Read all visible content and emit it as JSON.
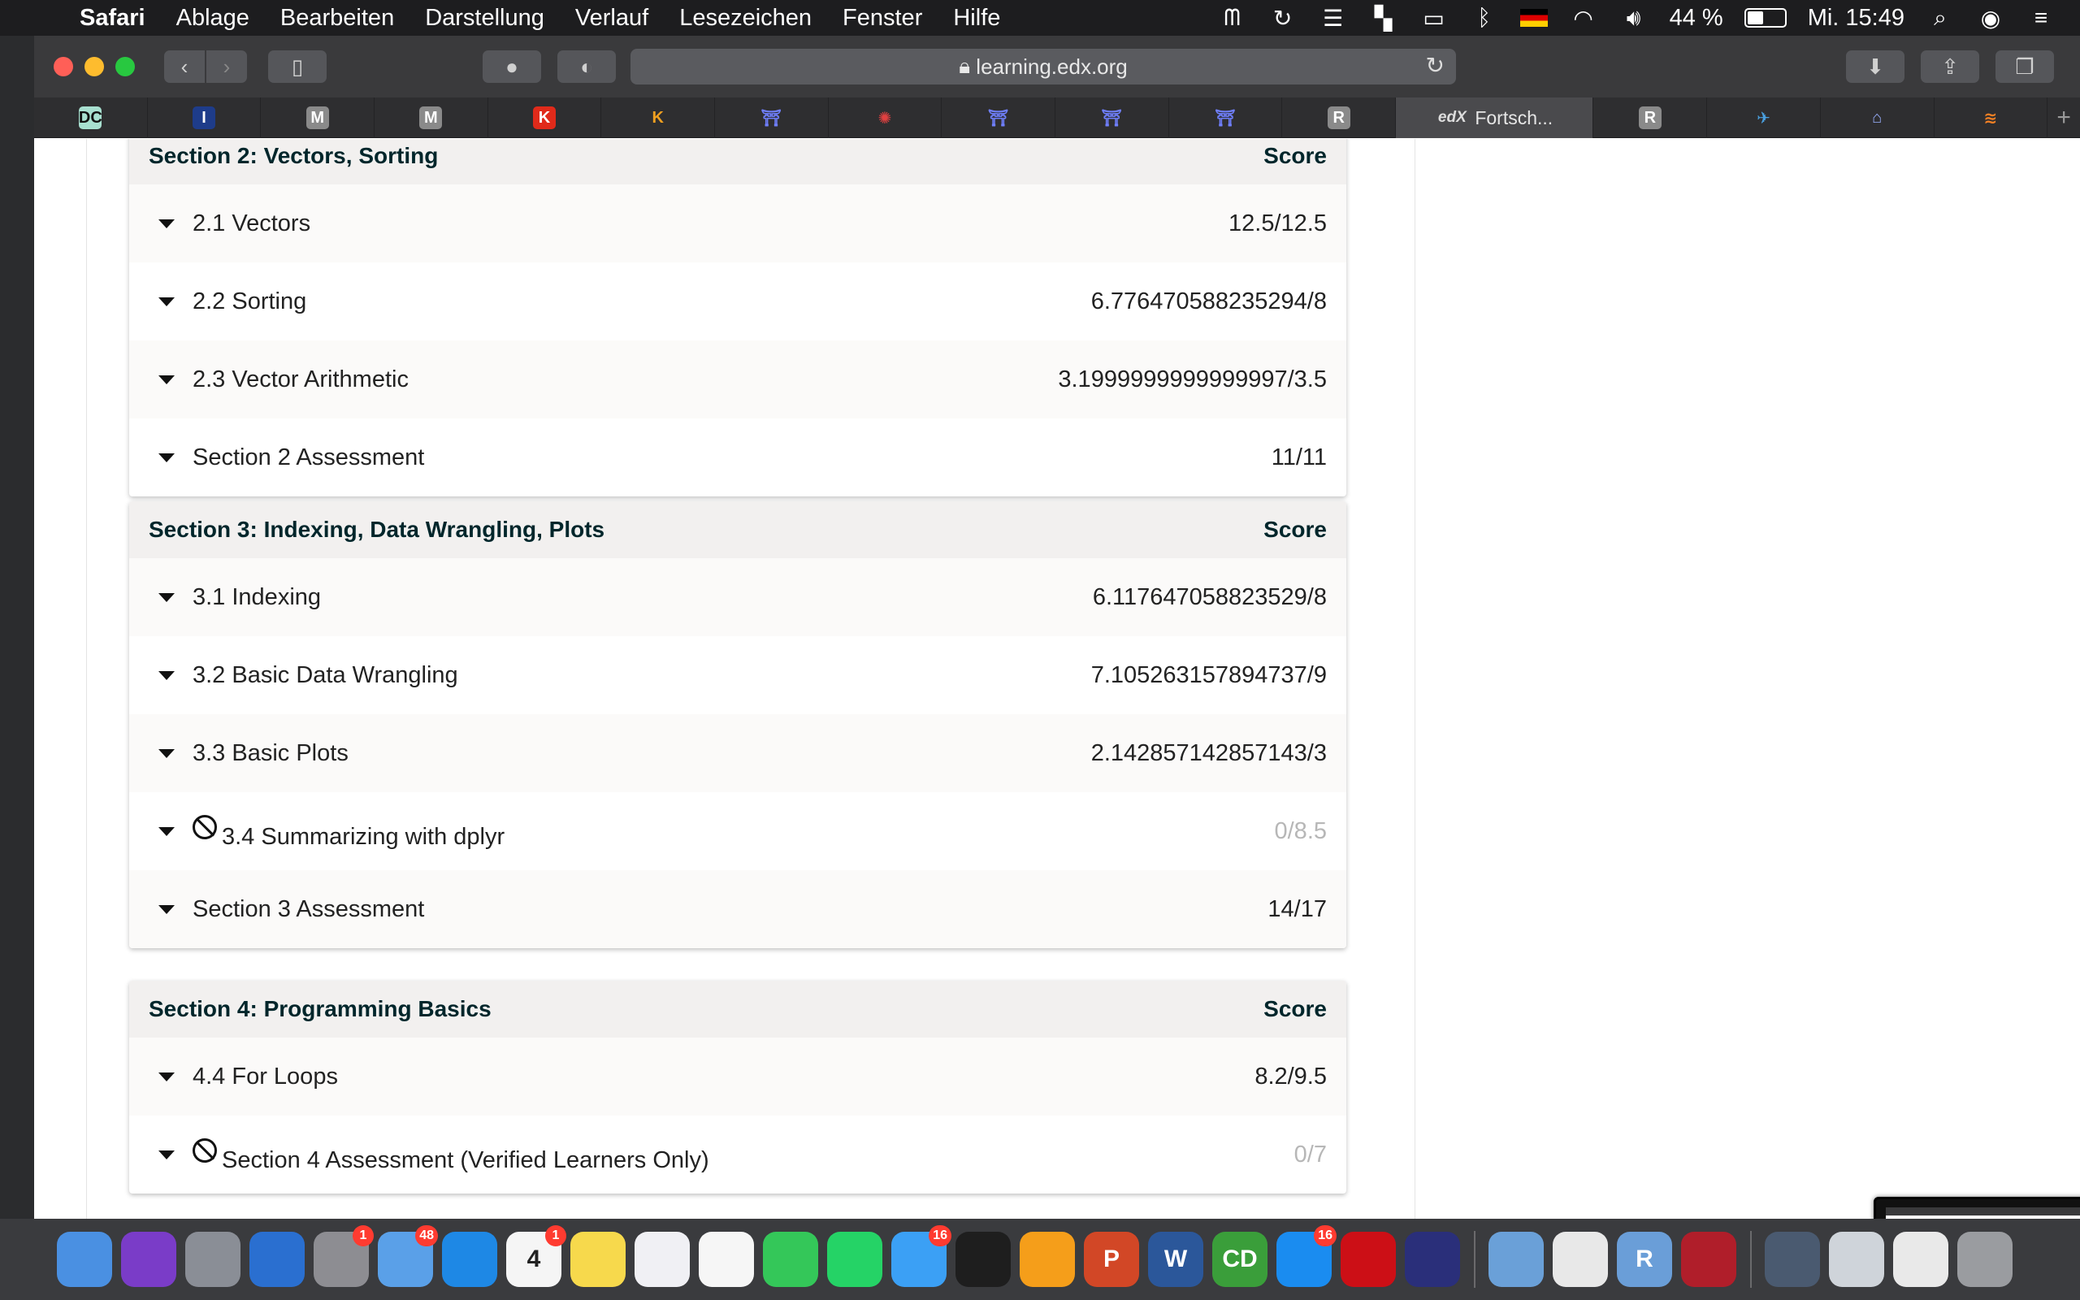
{
  "menubar": {
    "app_name": "Safari",
    "items": [
      "Ablage",
      "Bearbeiten",
      "Darstellung",
      "Verlauf",
      "Lesezeichen",
      "Fenster",
      "Hilfe"
    ],
    "battery_percent": "44 %",
    "clock": "Mi. 15:49"
  },
  "toolbar": {
    "url": "learning.edx.org"
  },
  "tabs": [
    {
      "icon": "datacamp-icon",
      "glyph": "DC",
      "color": "#a8e0d0",
      "fg": "#111"
    },
    {
      "icon": "i-icon",
      "glyph": "I",
      "color": "#1e3c8a",
      "fg": "#fff"
    },
    {
      "icon": "m-icon",
      "glyph": "M",
      "color": "#8a8a8a",
      "fg": "#fff"
    },
    {
      "icon": "m-icon",
      "glyph": "M",
      "color": "#8a8a8a",
      "fg": "#fff"
    },
    {
      "icon": "k-icon",
      "glyph": "K",
      "color": "#e02a1a",
      "fg": "#fff"
    },
    {
      "icon": "k-logo-icon",
      "glyph": "K",
      "color": "transparent",
      "fg": "#f0a020"
    },
    {
      "icon": "building-icon",
      "glyph": "⛩",
      "color": "transparent",
      "fg": "#7080ff"
    },
    {
      "icon": "bug-icon",
      "glyph": "✺",
      "color": "transparent",
      "fg": "#e04040"
    },
    {
      "icon": "building-icon",
      "glyph": "⛩",
      "color": "transparent",
      "fg": "#7080ff"
    },
    {
      "icon": "building-icon",
      "glyph": "⛩",
      "color": "transparent",
      "fg": "#7080ff"
    },
    {
      "icon": "building-icon",
      "glyph": "⛩",
      "color": "transparent",
      "fg": "#7080ff"
    },
    {
      "icon": "r-icon",
      "glyph": "R",
      "color": "#8a8a8a",
      "fg": "#fff"
    }
  ],
  "active_tab": {
    "icon_text": "edX",
    "label": "Fortsch..."
  },
  "tabs_after": [
    {
      "icon": "r-icon",
      "glyph": "R",
      "color": "#8a8a8a",
      "fg": "#fff"
    },
    {
      "icon": "bird-icon",
      "glyph": "✈",
      "color": "transparent",
      "fg": "#4aa0e0"
    },
    {
      "icon": "temple-icon",
      "glyph": "⌂",
      "color": "transparent",
      "fg": "#9ab0ff"
    },
    {
      "icon": "stack-icon",
      "glyph": "≋",
      "color": "transparent",
      "fg": "#f48024"
    }
  ],
  "sections": [
    {
      "title": "Section 2: Vectors, Sorting",
      "score_header": "Score",
      "rows": [
        {
          "label": "2.1 Vectors",
          "score": "12.5/12.5",
          "locked": false
        },
        {
          "label": "2.2 Sorting",
          "score": "6.776470588235294/8",
          "locked": false
        },
        {
          "label": "2.3 Vector Arithmetic",
          "score": "3.1999999999999997/3.5",
          "locked": false
        },
        {
          "label": "Section 2 Assessment",
          "score": "11/11",
          "locked": false
        }
      ]
    },
    {
      "title": "Section 3: Indexing, Data Wrangling, Plots",
      "score_header": "Score",
      "rows": [
        {
          "label": "3.1 Indexing",
          "score": "6.117647058823529/8",
          "locked": false
        },
        {
          "label": "3.2 Basic Data Wrangling",
          "score": "7.105263157894737/9",
          "locked": false
        },
        {
          "label": "3.3 Basic Plots",
          "score": "2.142857142857143/3",
          "locked": false
        },
        {
          "label": "3.4 Summarizing with dplyr",
          "score": "0/8.5",
          "locked": true
        },
        {
          "label": "Section 3 Assessment",
          "score": "14/17",
          "locked": false
        }
      ]
    },
    {
      "title": "Section 4: Programming Basics",
      "score_header": "Score",
      "rows": [
        {
          "label": "4.4 For Loops",
          "score": "8.2/9.5",
          "locked": false
        },
        {
          "label": "Section 4 Assessment (Verified Learners Only)",
          "score": "0/7",
          "locked": true
        }
      ]
    }
  ],
  "dock": [
    {
      "name": "finder-icon",
      "color": "#4a90e2"
    },
    {
      "name": "siri-icon",
      "color": "#7a3cc8"
    },
    {
      "name": "launchpad-icon",
      "color": "#8a8e96"
    },
    {
      "name": "mission-control-icon",
      "color": "#2a6fd0"
    },
    {
      "name": "system-preferences-icon",
      "color": "#8d8d92",
      "badge": "1"
    },
    {
      "name": "mail-icon",
      "color": "#5aa0e8",
      "badge": "48"
    },
    {
      "name": "safari-icon",
      "color": "#1e88e5"
    },
    {
      "name": "calendar-icon",
      "color": "#f5f5f5",
      "text": "4",
      "badge": "1"
    },
    {
      "name": "notes-icon",
      "color": "#f7d94c"
    },
    {
      "name": "music-icon",
      "color": "#f0f0f4"
    },
    {
      "name": "photos-icon",
      "color": "#f6f6f6"
    },
    {
      "name": "facetime-icon",
      "color": "#34c759"
    },
    {
      "name": "whatsapp-icon",
      "color": "#25d366"
    },
    {
      "name": "messages-icon",
      "color": "#3ba0f5",
      "badge": "16"
    },
    {
      "name": "teams-icon",
      "color": "#1e1e1e"
    },
    {
      "name": "books-icon",
      "color": "#f59e1a"
    },
    {
      "name": "powerpoint-icon",
      "color": "#d24726",
      "text": "P"
    },
    {
      "name": "word-icon",
      "color": "#2b579a",
      "text": "W"
    },
    {
      "name": "cd-icon",
      "color": "#3a9e3a",
      "text": "CD"
    },
    {
      "name": "app-store-icon",
      "color": "#1a8cf0",
      "badge": "16"
    },
    {
      "name": "opera-icon",
      "color": "#cc0f16"
    },
    {
      "name": "night-icon",
      "color": "#2a2f7a"
    },
    {
      "name": "preview-icon",
      "color": "#6aa0d8"
    },
    {
      "name": "textedit-icon",
      "color": "#e8e8e8"
    },
    {
      "name": "r-icon",
      "color": "#6a9ed8",
      "text": "R"
    },
    {
      "name": "photo-booth-icon",
      "color": "#b01e2a"
    },
    {
      "name": "download-stack-icon",
      "color": "#4a5a70"
    },
    {
      "name": "screenshot-stack-icon",
      "color": "#cfd4da"
    },
    {
      "name": "document-stack-icon",
      "color": "#e9e9e9"
    },
    {
      "name": "trash-icon",
      "color": "#9a9ca0"
    }
  ]
}
